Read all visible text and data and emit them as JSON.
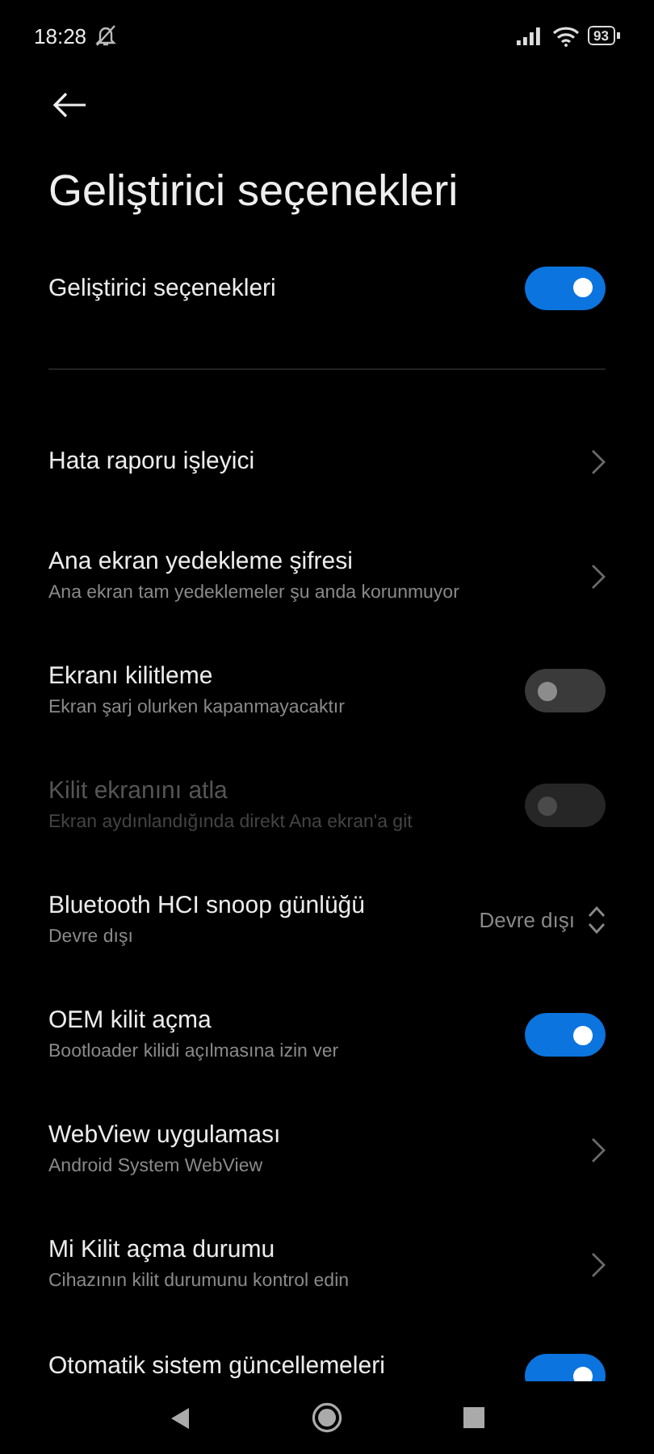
{
  "status_bar": {
    "time": "18:28",
    "battery": "93"
  },
  "title": "Geliştirici seçenekleri",
  "master": {
    "title": "Geliştirici seçenekleri",
    "on": true
  },
  "items": [
    {
      "kind": "chevron",
      "title": "Hata raporu işleyici",
      "disabled": false
    },
    {
      "kind": "chevron",
      "title": "Ana ekran yedekleme şifresi",
      "subtitle": "Ana ekran tam yedeklemeler şu anda korunmuyor",
      "disabled": false
    },
    {
      "kind": "toggle",
      "title": "Ekranı kilitleme",
      "subtitle": "Ekran şarj olurken kapanmayacaktır",
      "on": false,
      "disabled": false
    },
    {
      "kind": "toggle",
      "title": "Kilit ekranını atla",
      "subtitle": "Ekran aydınlandığında direkt Ana ekran'a git",
      "on": false,
      "disabled": true
    },
    {
      "kind": "select",
      "title": "Bluetooth HCI snoop günlüğü",
      "subtitle": "Devre dışı",
      "value": "Devre dışı",
      "disabled": false
    },
    {
      "kind": "toggle",
      "title": "OEM kilit açma",
      "subtitle": "Bootloader kilidi açılmasına izin ver",
      "on": true,
      "disabled": false
    },
    {
      "kind": "chevron",
      "title": "WebView uygulaması",
      "subtitle": "Android System WebView",
      "disabled": false
    },
    {
      "kind": "chevron",
      "title": "Mi Kilit açma durumu",
      "subtitle": "Cihazının kilit durumunu kontrol edin",
      "disabled": false
    },
    {
      "kind": "toggle",
      "title": "Otomatik sistem güncellemeleri",
      "on": true,
      "disabled": false
    }
  ]
}
